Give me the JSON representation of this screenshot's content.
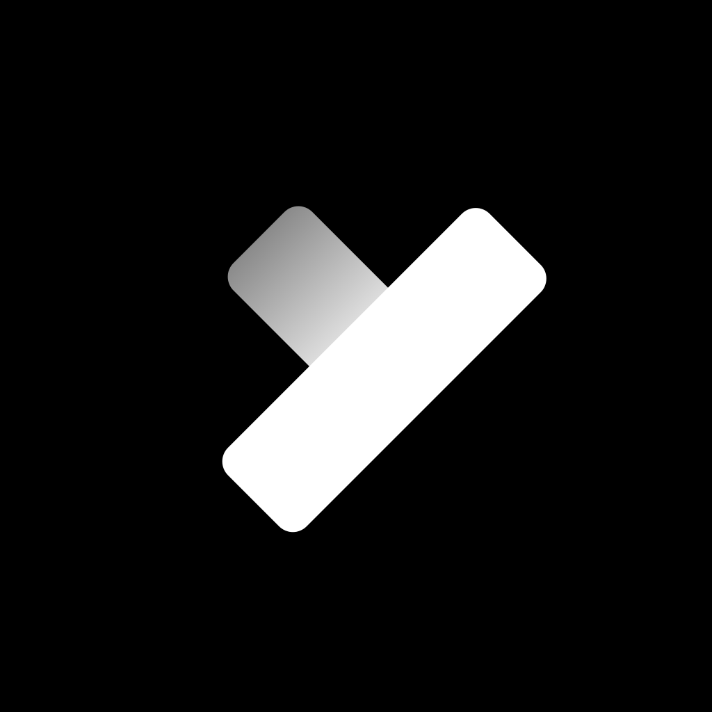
{
  "icon": {
    "name": "checkmark-icon",
    "colors": {
      "background": "#000000",
      "long_stroke": "#ffffff",
      "short_stroke_light": "#ffffff",
      "short_stroke_dark": "#8a8a8a"
    }
  }
}
